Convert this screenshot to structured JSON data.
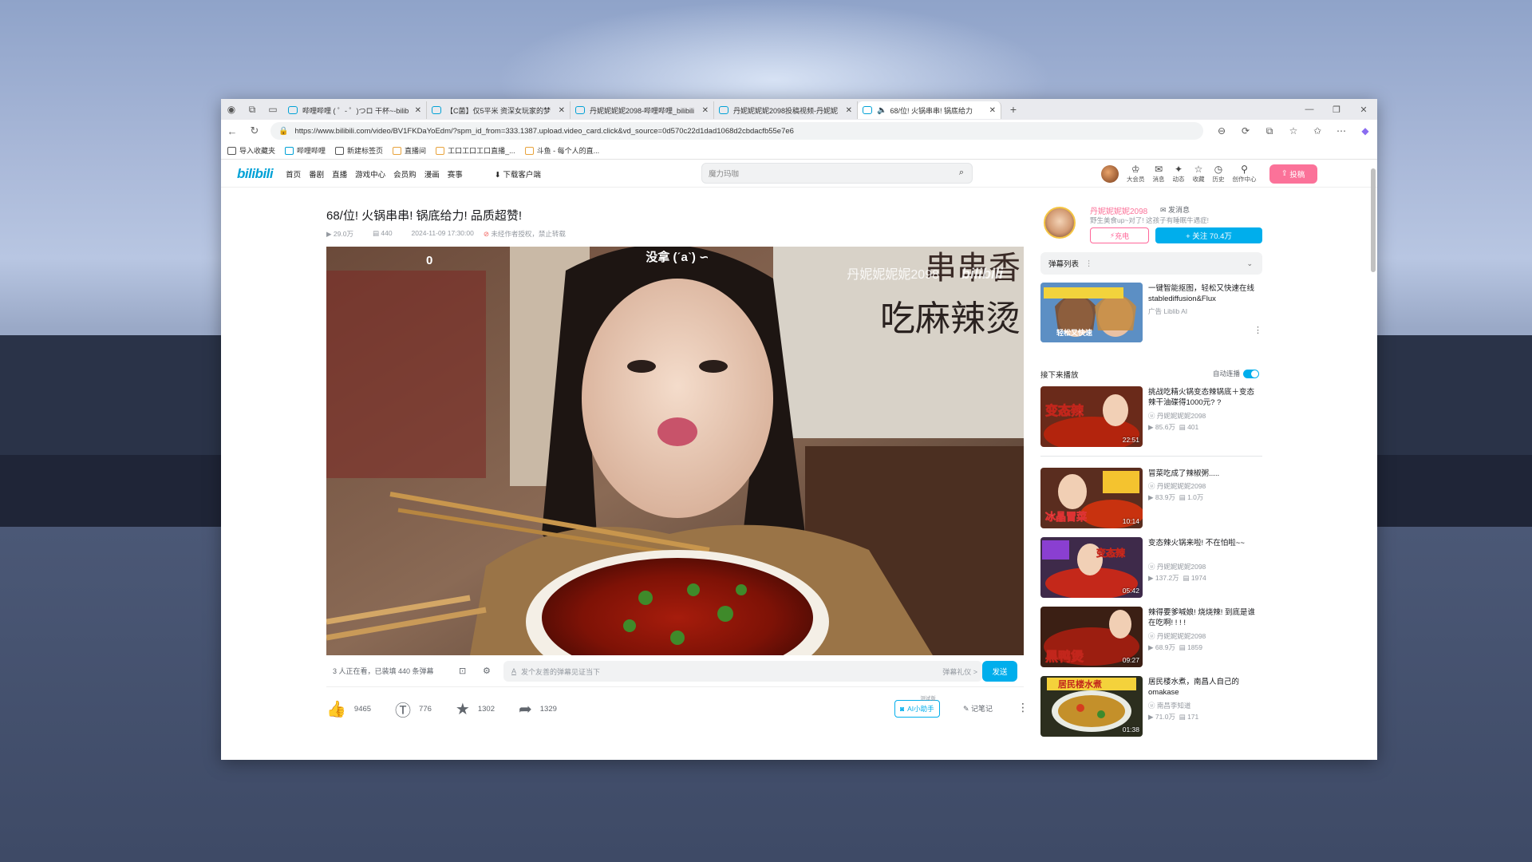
{
  "browser": {
    "tabs": [
      {
        "label": "哔哩哔哩 ( ゜- ゜)つロ 干杯~-bilib"
      },
      {
        "label": "【C菌】仅5平米 资深女玩家的梦"
      },
      {
        "label": "丹妮妮妮妮2098-哔哩哔哩_bilibili"
      },
      {
        "label": "丹妮妮妮妮2098投稿视频-丹妮妮"
      },
      {
        "label": "68/位! 火锅串串! 锅底给力"
      }
    ],
    "url": "https://www.bilibili.com/video/BV1FKDaYoEdm/?spm_id_from=333.1387.upload.video_card.click&vd_source=0d570c22d1dad1068d2cbdacfb55e7e6",
    "bookmarks": [
      "导入收藏夹",
      "哔哩哔哩",
      "新建标签页",
      "直播间",
      "工口工口工口直播_...",
      "斗鱼 - 每个人的直..."
    ]
  },
  "header": {
    "logo": "bilibili",
    "nav": [
      "首页",
      "番剧",
      "直播",
      "游戏中心",
      "会员购",
      "漫画",
      "赛事"
    ],
    "download": "下载客户端",
    "search_placeholder": "魔力玛咖",
    "icons": [
      {
        "label": "大会员",
        "icon": "crown-icon"
      },
      {
        "label": "消息",
        "icon": "mail-icon"
      },
      {
        "label": "动态",
        "icon": "wind-icon"
      },
      {
        "label": "收藏",
        "icon": "star-icon"
      },
      {
        "label": "历史",
        "icon": "clock-icon"
      },
      {
        "label": "创作中心",
        "icon": "bulb-icon"
      }
    ],
    "upload": "投稿"
  },
  "video": {
    "title": "68/位! 火锅串串! 锅底给力! 品质超赞!",
    "views": "29.0万",
    "danmaku_count": "440",
    "date": "2024-11-09 17:30:00",
    "copyright": "未经作者授权，禁止转载",
    "overlay_counter": "0",
    "overlay_caption": "没拿 (ˊaˋ) ∽",
    "overlay_watermark": "丹妮妮妮妮2098",
    "overlay_logo": "bilibili",
    "wall_text": "吃麻辣烫",
    "wall_text2": "串串香"
  },
  "danmaku_bar": {
    "status": "3 人正在看，已装填 440 条弹幕",
    "placeholder": "发个友善的弹幕见证当下",
    "etiquette": "弹幕礼仪 >",
    "send": "发送"
  },
  "toolbar": {
    "like": "9465",
    "coin": "776",
    "fav": "1302",
    "share": "1329",
    "ai": "AI小助手",
    "ai_badge": "测试版",
    "note": "记笔记"
  },
  "uploader": {
    "name": "丹妮妮妮妮2098",
    "message": "发消息",
    "desc": "野生美食up~对了! 这孩子有睡眠牛遇症!",
    "charge": "充电",
    "follow": "+ 关注 70.4万"
  },
  "danmaku_list": {
    "label": "弹幕列表"
  },
  "ad": {
    "title": "一键智能抠图，轻松又快速在线stablediffusion&Flux",
    "sub": "广告 Liblib AI",
    "thumb_text": "轻松又快速"
  },
  "next_up": {
    "label": "接下来播放",
    "autoplay": "自动连播"
  },
  "recommendations": [
    {
      "title": "挑战吃精火锅变态辣锅底＋变态辣干油碟得1000元? ?",
      "author": "丹妮妮妮妮2098",
      "views": "85.6万",
      "danmaku": "401",
      "duration": "22:51",
      "thumb_text": "变态辣"
    },
    {
      "title": "冒菜吃成了辣椒粥.....",
      "author": "丹妮妮妮妮2098",
      "views": "83.9万",
      "danmaku": "1.0万",
      "duration": "10:14",
      "thumb_text": "冰晶冒菜"
    },
    {
      "title": "变态辣火锅来啦! 不在怕啦~~",
      "author": "丹妮妮妮妮2098",
      "views": "137.2万",
      "danmaku": "1974",
      "duration": "05:42",
      "thumb_text": "变态辣"
    },
    {
      "title": "辣得要爹喊娘! 烧烧辣! 到底是谁在吃啊! ! ! !",
      "author": "丹妮妮妮妮2098",
      "views": "68.9万",
      "danmaku": "1859",
      "duration": "09:27",
      "thumb_text": "黑鸭煲"
    },
    {
      "title": "居民楼水煮，南昌人自己的omakase",
      "author": "南昌李知道",
      "views": "71.0万",
      "danmaku": "171",
      "duration": "01:38",
      "thumb_text": "居民楼水煮"
    }
  ]
}
